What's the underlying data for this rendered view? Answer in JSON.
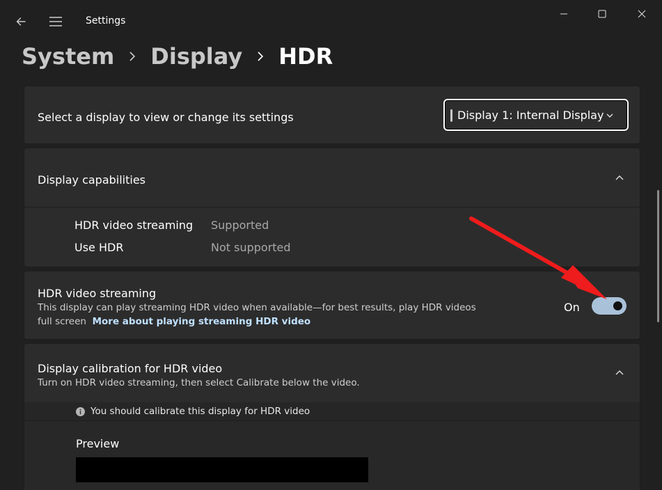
{
  "window": {
    "title": "Settings"
  },
  "breadcrumb": {
    "items": [
      "System",
      "Display",
      "HDR"
    ]
  },
  "display_select": {
    "label": "Select a display to view or change its settings",
    "selected": "Display 1: Internal Display"
  },
  "capabilities": {
    "title": "Display capabilities",
    "rows": [
      {
        "name": "HDR video streaming",
        "value": "Supported"
      },
      {
        "name": "Use HDR",
        "value": "Not supported"
      }
    ]
  },
  "hdr_streaming": {
    "title": "HDR video streaming",
    "description_line1": "This display can play streaming HDR video when available—for best results, play HDR videos",
    "description_line2": "full screen",
    "link": "More about playing streaming HDR video",
    "toggle_state": "On"
  },
  "calibration": {
    "title": "Display calibration for HDR video",
    "subtitle": "Turn on HDR video streaming, then select Calibrate below the video.",
    "info": "You should calibrate this display for HDR video",
    "preview_label": "Preview"
  },
  "colors": {
    "background": "#202020",
    "card": "#2c2c2c",
    "toggle_on": "#a9c2da",
    "link": "#bfe0ff",
    "annotation_arrow": "#ee1c1c"
  }
}
